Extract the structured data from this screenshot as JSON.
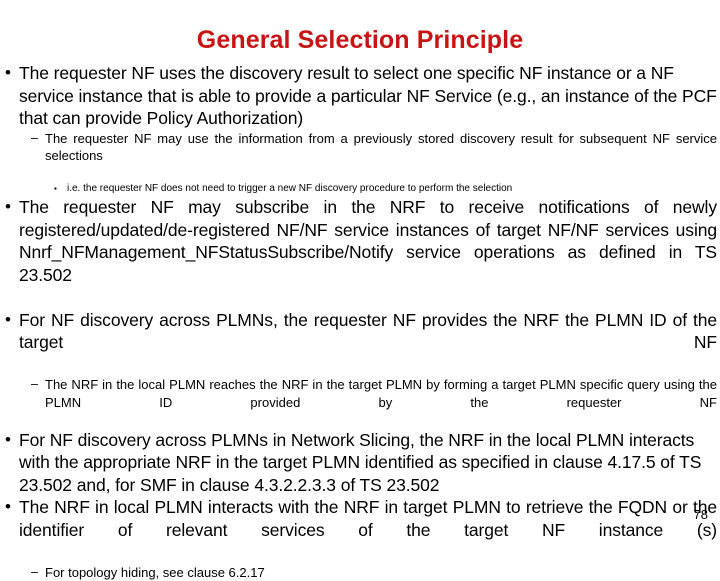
{
  "slide": {
    "title": "General Selection Principle",
    "title_color": "#c81414",
    "page_number": "78",
    "bullet_marker_l1": "•",
    "bullet_marker_l2": "–",
    "bullet_marker_l3": "▪",
    "content": [
      {
        "level": 1,
        "justify": false,
        "text": "The requester NF uses the discovery result to select one specific NF instance or a NF service instance that is able to provide a particular NF Service (e.g., an instance of the PCF that can provide Policy Authorization)"
      },
      {
        "level": 2,
        "justify": true,
        "text": "The requester NF may use the information from a previously stored discovery result for subsequent NF service selections"
      },
      {
        "level": 3,
        "justify": false,
        "text": "i.e. the requester NF does not need to trigger a new NF discovery procedure to perform the selection"
      },
      {
        "level": 1,
        "justify": true,
        "text": "The requester NF may subscribe in the NRF to receive notifications of newly registered/updated/de-registered NF/NF service instances of target NF/NF services using Nnrf_NFManagement_NFStatusSubscribe/Notify service operations as defined in TS 23.502"
      },
      {
        "level": 1,
        "justify": true,
        "text": "For NF discovery across PLMNs, the requester NF provides the NRF the PLMN ID of the target NF"
      },
      {
        "level": 2,
        "justify": true,
        "text": "The NRF in the local PLMN reaches the NRF in the target PLMN by forming a target PLMN specific query using the PLMN ID provided by the requester NF"
      },
      {
        "level": 1,
        "justify": false,
        "text": "For NF discovery across PLMNs in Network Slicing, the NRF in the local PLMN interacts with the appropriate NRF in the target PLMN identified as specified in clause 4.17.5 of TS 23.502 and, for SMF in clause 4.3.2.2.3.3 of TS 23.502"
      },
      {
        "level": 1,
        "justify": true,
        "text": "The NRF in local PLMN interacts with the NRF in target PLMN to retrieve the FQDN or the identifier of relevant services of the target NF instance (s)"
      },
      {
        "level": 2,
        "justify": false,
        "text": "For topology hiding, see clause 6.2.17"
      }
    ]
  }
}
